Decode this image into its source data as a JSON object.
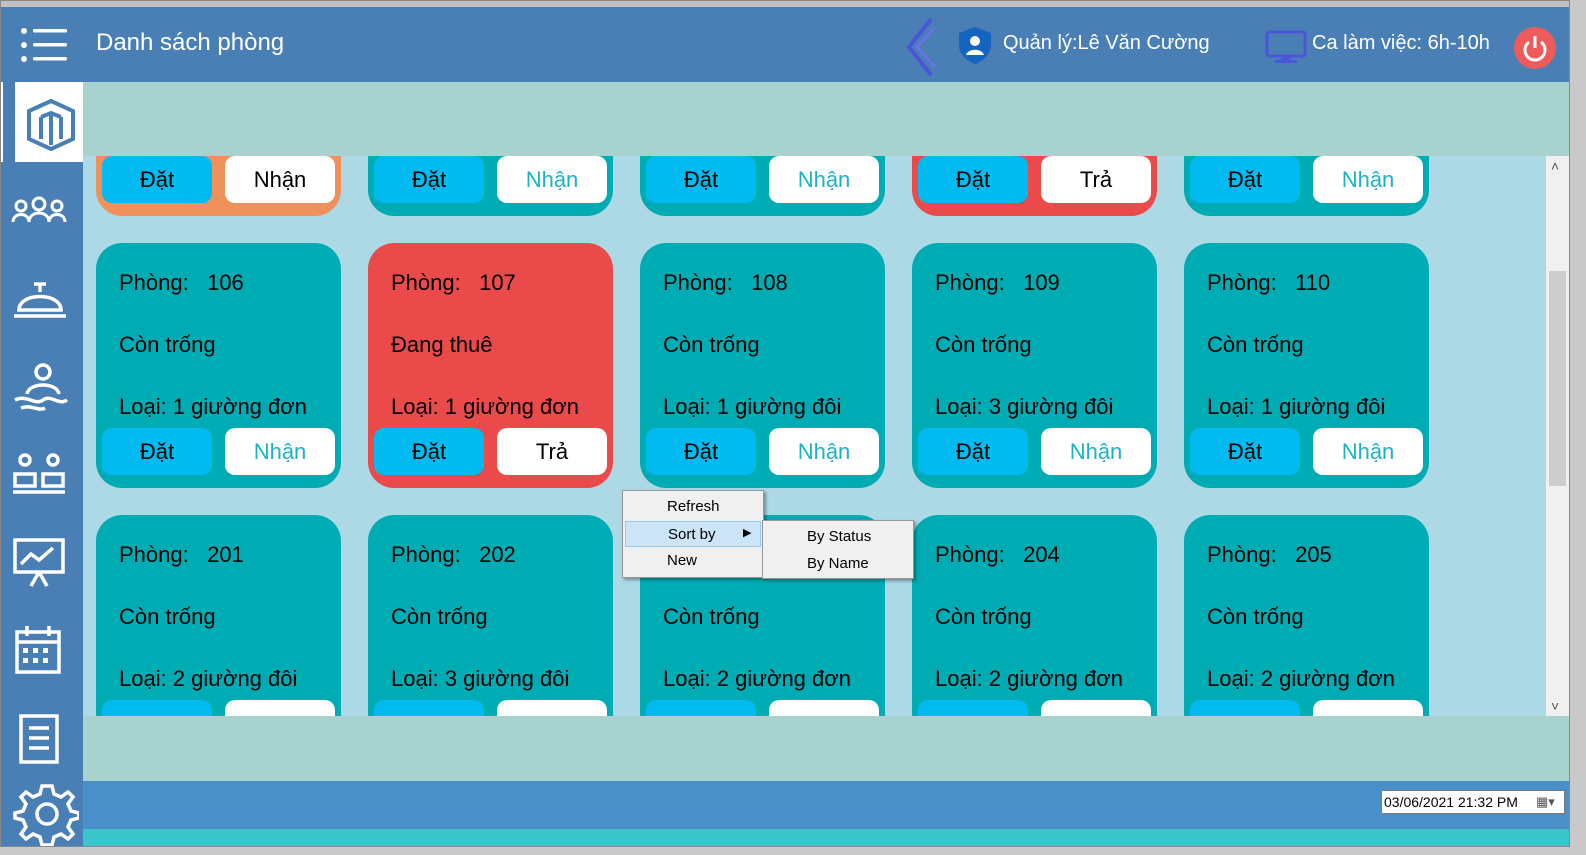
{
  "header": {
    "title": "Danh sách phòng",
    "manager": "Quản lý:Lê Văn Cường",
    "shift": "Ca làm việc: 6h-10h"
  },
  "sidebar": [
    {
      "icon": "rooms-icon"
    },
    {
      "icon": "customers-icon"
    },
    {
      "icon": "service-bell-icon"
    },
    {
      "icon": "guest-icon"
    },
    {
      "icon": "staff-icon"
    },
    {
      "icon": "statistics-icon"
    },
    {
      "icon": "calendar-icon"
    },
    {
      "icon": "invoice-icon"
    },
    {
      "icon": "settings-icon"
    }
  ],
  "room_label": "Phòng:",
  "book_label": "Đặt",
  "top_row_actions": [
    "Nhận",
    "Nhận",
    "Nhận",
    "Trả",
    "Nhận"
  ],
  "rooms_row2": [
    {
      "number": "106",
      "status": "Còn trống",
      "type": "Loại: 1 giường đơn",
      "action": "Nhận"
    },
    {
      "number": "107",
      "status": "Đang thuê",
      "type": "Loại: 1 giường đơn",
      "action": "Trả"
    },
    {
      "number": "108",
      "status": "Còn trống",
      "type": "Loại: 1 giường đôi",
      "action": "Nhận"
    },
    {
      "number": "109",
      "status": "Còn trống",
      "type": "Loại: 3 giường đôi",
      "action": "Nhận"
    },
    {
      "number": "110",
      "status": "Còn trống",
      "type": "Loại: 1 giường đôi",
      "action": "Nhận"
    }
  ],
  "rooms_row3": [
    {
      "number": "201",
      "status": "Còn trống",
      "type": "Loại: 2 giường đôi"
    },
    {
      "number": "202",
      "status": "Còn trống",
      "type": "Loại: 3 giường đôi"
    },
    {
      "number": "",
      "status": "Còn trống",
      "type": "Loại: 2 giường đơn"
    },
    {
      "number": "204",
      "status": "Còn trống",
      "type": "Loại: 2 giường đơn"
    },
    {
      "number": "205",
      "status": "Còn trống",
      "type": "Loại: 2 giường đơn"
    }
  ],
  "context_menu": {
    "items": [
      "Refresh",
      "Sort by",
      "New"
    ],
    "submenu": [
      "By Status",
      "By Name"
    ]
  },
  "footer": {
    "datetime": "03/06/2021 21:32 PM"
  },
  "colors": {
    "header": "#4a7fb5",
    "available": "#00acb4",
    "rented": "#ea4a4a",
    "reserved": "#f0905a",
    "book_button": "#00baf0"
  }
}
